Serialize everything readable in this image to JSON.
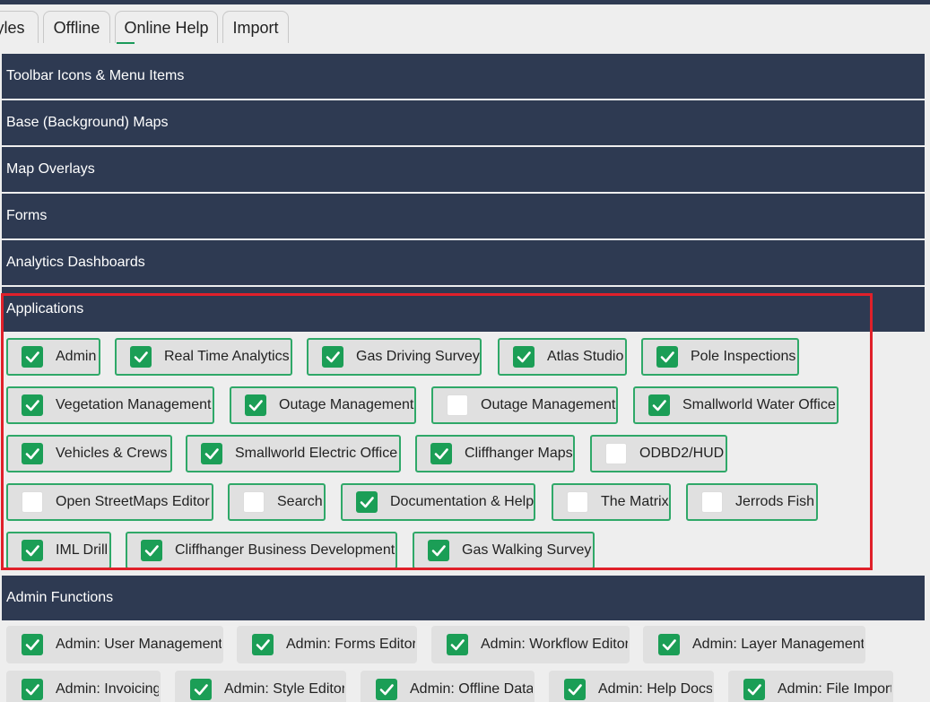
{
  "tabs": [
    {
      "label": "yles"
    },
    {
      "label": "Offline"
    },
    {
      "label": "Online Help"
    },
    {
      "label": "Import"
    }
  ],
  "sections": [
    {
      "title": "Toolbar Icons & Menu Items"
    },
    {
      "title": "Base (Background) Maps"
    },
    {
      "title": "Map Overlays"
    },
    {
      "title": "Forms"
    },
    {
      "title": "Analytics Dashboards"
    },
    {
      "title": "Applications"
    },
    {
      "title": "Admin Functions"
    }
  ],
  "applications": [
    {
      "label": "Admin",
      "checked": true
    },
    {
      "label": "Real Time Analytics",
      "checked": true
    },
    {
      "label": "Gas Driving Survey",
      "checked": true
    },
    {
      "label": "Atlas Studio",
      "checked": true
    },
    {
      "label": "Pole Inspections",
      "checked": true
    },
    {
      "label": "Vegetation Management",
      "checked": true
    },
    {
      "label": "Outage Management",
      "checked": true
    },
    {
      "label": "Outage Management",
      "checked": false
    },
    {
      "label": "Smallworld Water Office",
      "checked": true
    },
    {
      "label": "Vehicles & Crews",
      "checked": true
    },
    {
      "label": "Smallworld Electric Office",
      "checked": true
    },
    {
      "label": "Cliffhanger Maps",
      "checked": true
    },
    {
      "label": "ODBD2/HUD",
      "checked": false
    },
    {
      "label": "Open StreetMaps Editor",
      "checked": false
    },
    {
      "label": "Search",
      "checked": false
    },
    {
      "label": "Documentation & Help",
      "checked": true
    },
    {
      "label": "The Matrix",
      "checked": false
    },
    {
      "label": "Jerrods Fish",
      "checked": false
    },
    {
      "label": "IML Drill",
      "checked": true
    },
    {
      "label": "Cliffhanger Business Development",
      "checked": true
    },
    {
      "label": "Gas Walking Survey",
      "checked": true
    }
  ],
  "admin_functions": [
    {
      "label": "Admin: User Management",
      "checked": true
    },
    {
      "label": "Admin: Forms Editor",
      "checked": true
    },
    {
      "label": "Admin: Workflow Editor",
      "checked": true
    },
    {
      "label": "Admin: Layer Management",
      "checked": true
    },
    {
      "label": "Admin: Invoicing",
      "checked": true
    },
    {
      "label": "Admin: Style Editor",
      "checked": true
    },
    {
      "label": "Admin: Offline Data",
      "checked": true
    },
    {
      "label": "Admin: Help Docs",
      "checked": true
    },
    {
      "label": "Admin: File Import",
      "checked": true
    }
  ],
  "colors": {
    "section_header": "#2e3a52",
    "checkbox_checked": "#1b9e56",
    "chip_border": "#2fa868",
    "highlight": "#e0202a"
  }
}
